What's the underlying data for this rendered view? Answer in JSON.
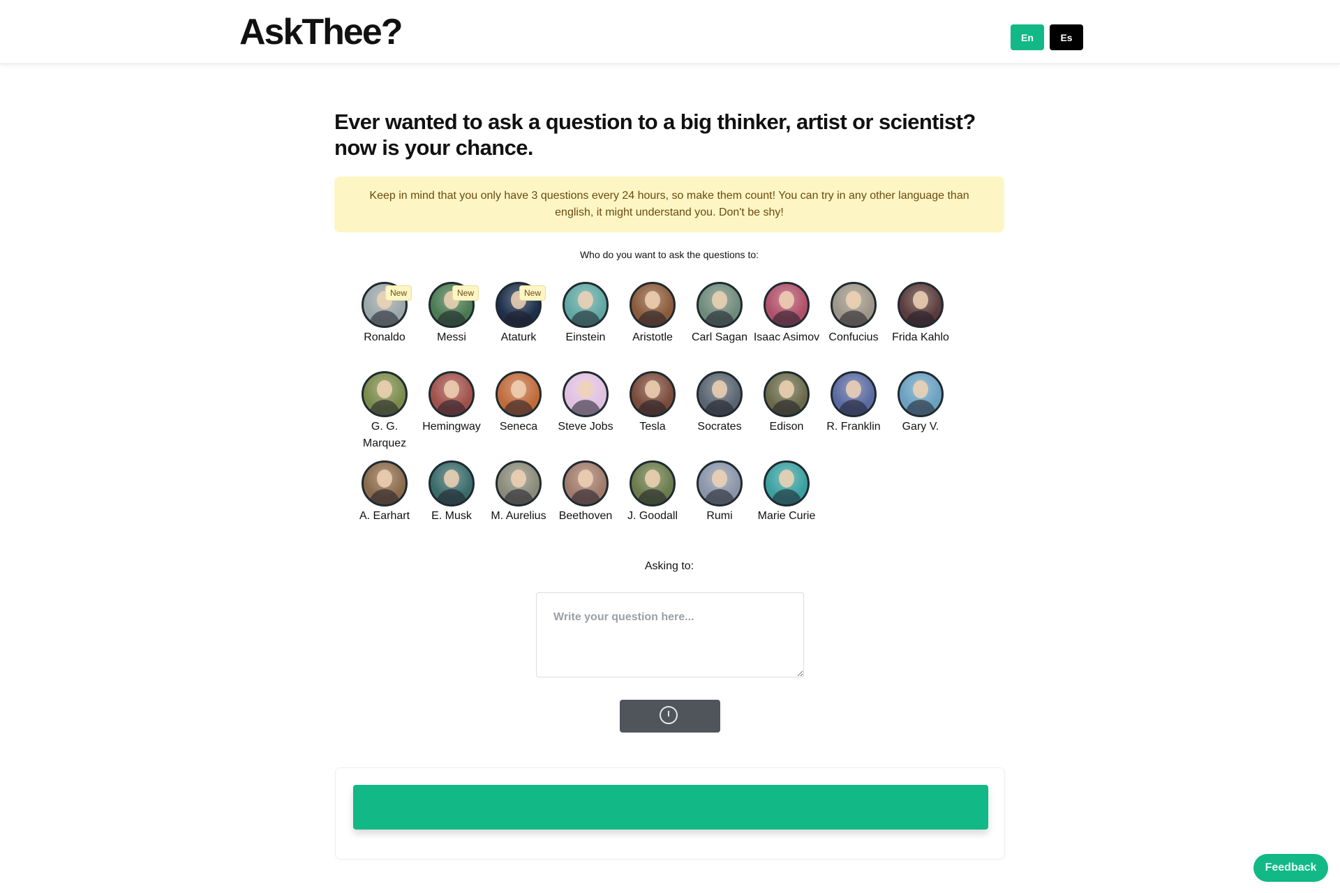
{
  "header": {
    "logo": "AskThee?",
    "languages": [
      {
        "label": "En",
        "color": "#12b886"
      },
      {
        "label": "Es",
        "color": "#000000"
      }
    ]
  },
  "main": {
    "headline": "Ever wanted to ask a question to a big thinker, artist or scientist? now is your chance.",
    "notice": "Keep in mind that you only have 3 questions every 24 hours, so make them count!  You can try in any other language than english, it might understand you. Don't be shy!",
    "who_label": "Who do you want to ask the questions to:",
    "new_badge": "New",
    "people": [
      {
        "name": "Ronaldo",
        "is_new": true,
        "bg": "#9aa6a8"
      },
      {
        "name": "Messi",
        "is_new": true,
        "bg": "#4b7a52"
      },
      {
        "name": "Ataturk",
        "is_new": true,
        "bg": "#1d2f4a"
      },
      {
        "name": "Einstein",
        "is_new": false,
        "bg": "#5fa7a3"
      },
      {
        "name": "Aristotle",
        "is_new": false,
        "bg": "#8a5a3a"
      },
      {
        "name": "Carl Sagan",
        "is_new": false,
        "bg": "#6e8a7a"
      },
      {
        "name": "Isaac Asimov",
        "is_new": false,
        "bg": "#b0506a"
      },
      {
        "name": "Confucius",
        "is_new": false,
        "bg": "#9c9486"
      },
      {
        "name": "Frida Kahlo",
        "is_new": false,
        "bg": "#5a3a3a"
      },
      {
        "name": "G. G. Marquez",
        "is_new": false,
        "bg": "#7a8a4a"
      },
      {
        "name": "Hemingway",
        "is_new": false,
        "bg": "#a0504a"
      },
      {
        "name": "Seneca",
        "is_new": false,
        "bg": "#c06a3a"
      },
      {
        "name": "Steve Jobs",
        "is_new": false,
        "bg": "#e0c0e0"
      },
      {
        "name": "Tesla",
        "is_new": false,
        "bg": "#7a4a3a"
      },
      {
        "name": "Socrates",
        "is_new": false,
        "bg": "#5a6470"
      },
      {
        "name": "Edison",
        "is_new": false,
        "bg": "#6a6a4a"
      },
      {
        "name": "R. Franklin",
        "is_new": false,
        "bg": "#5a6aa0"
      },
      {
        "name": "Gary V.",
        "is_new": false,
        "bg": "#6aa0c0"
      },
      {
        "name": "A. Earhart",
        "is_new": false,
        "bg": "#8a6a4a"
      },
      {
        "name": "E. Musk",
        "is_new": false,
        "bg": "#3a6a6a"
      },
      {
        "name": "M. Aurelius",
        "is_new": false,
        "bg": "#8a8a7a"
      },
      {
        "name": "Beethoven",
        "is_new": false,
        "bg": "#a07a6a"
      },
      {
        "name": "J. Goodall",
        "is_new": false,
        "bg": "#6a7a4a"
      },
      {
        "name": "Rumi",
        "is_new": false,
        "bg": "#8a94a8"
      },
      {
        "name": "Marie Curie",
        "is_new": false,
        "bg": "#3aa0a0"
      }
    ],
    "asking_to_label": "Asking to:",
    "question_placeholder": "Write your question here...",
    "submit_icon": "spinner-icon"
  },
  "feedback_label": "Feedback",
  "colors": {
    "accent": "#12b886",
    "notice_bg": "#fdf6c4",
    "submit_bg": "#50555c"
  }
}
